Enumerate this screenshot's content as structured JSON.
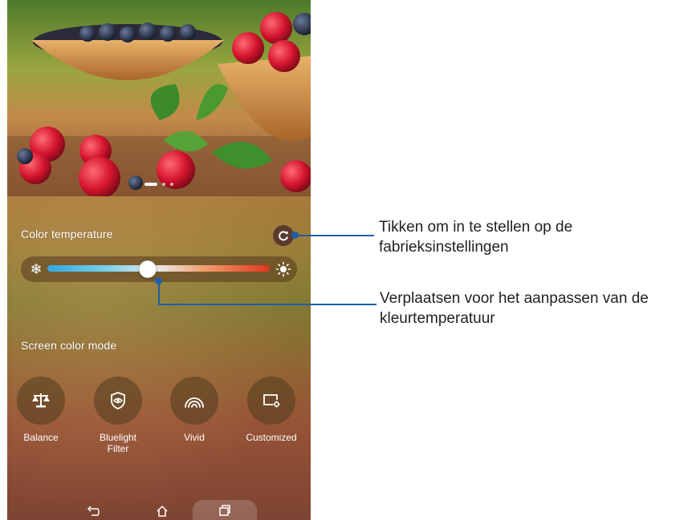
{
  "color_temperature": {
    "label": "Color temperature",
    "slider_value": 0.45
  },
  "screen_color_mode": {
    "label": "Screen color mode",
    "modes": [
      {
        "label": "Balance",
        "icon": "balance-scale-icon",
        "selected": true
      },
      {
        "label": "Bluelight Filter",
        "icon": "eye-shield-icon",
        "selected": false
      },
      {
        "label": "Vivid",
        "icon": "vivid-arcs-icon",
        "selected": false
      },
      {
        "label": "Customized",
        "icon": "customize-screen-icon",
        "selected": false
      }
    ]
  },
  "wallpaper_pager": {
    "pages": 3,
    "active_page": 1
  },
  "callouts": {
    "reset": "Tikken om in te stellen op de fabrieksinstellingen",
    "slider": "Verplaatsen voor het aanpassen van de kleurtemperatuur"
  },
  "colors": {
    "accent": "#f07a14",
    "callout_line": "#1f5fa6"
  }
}
